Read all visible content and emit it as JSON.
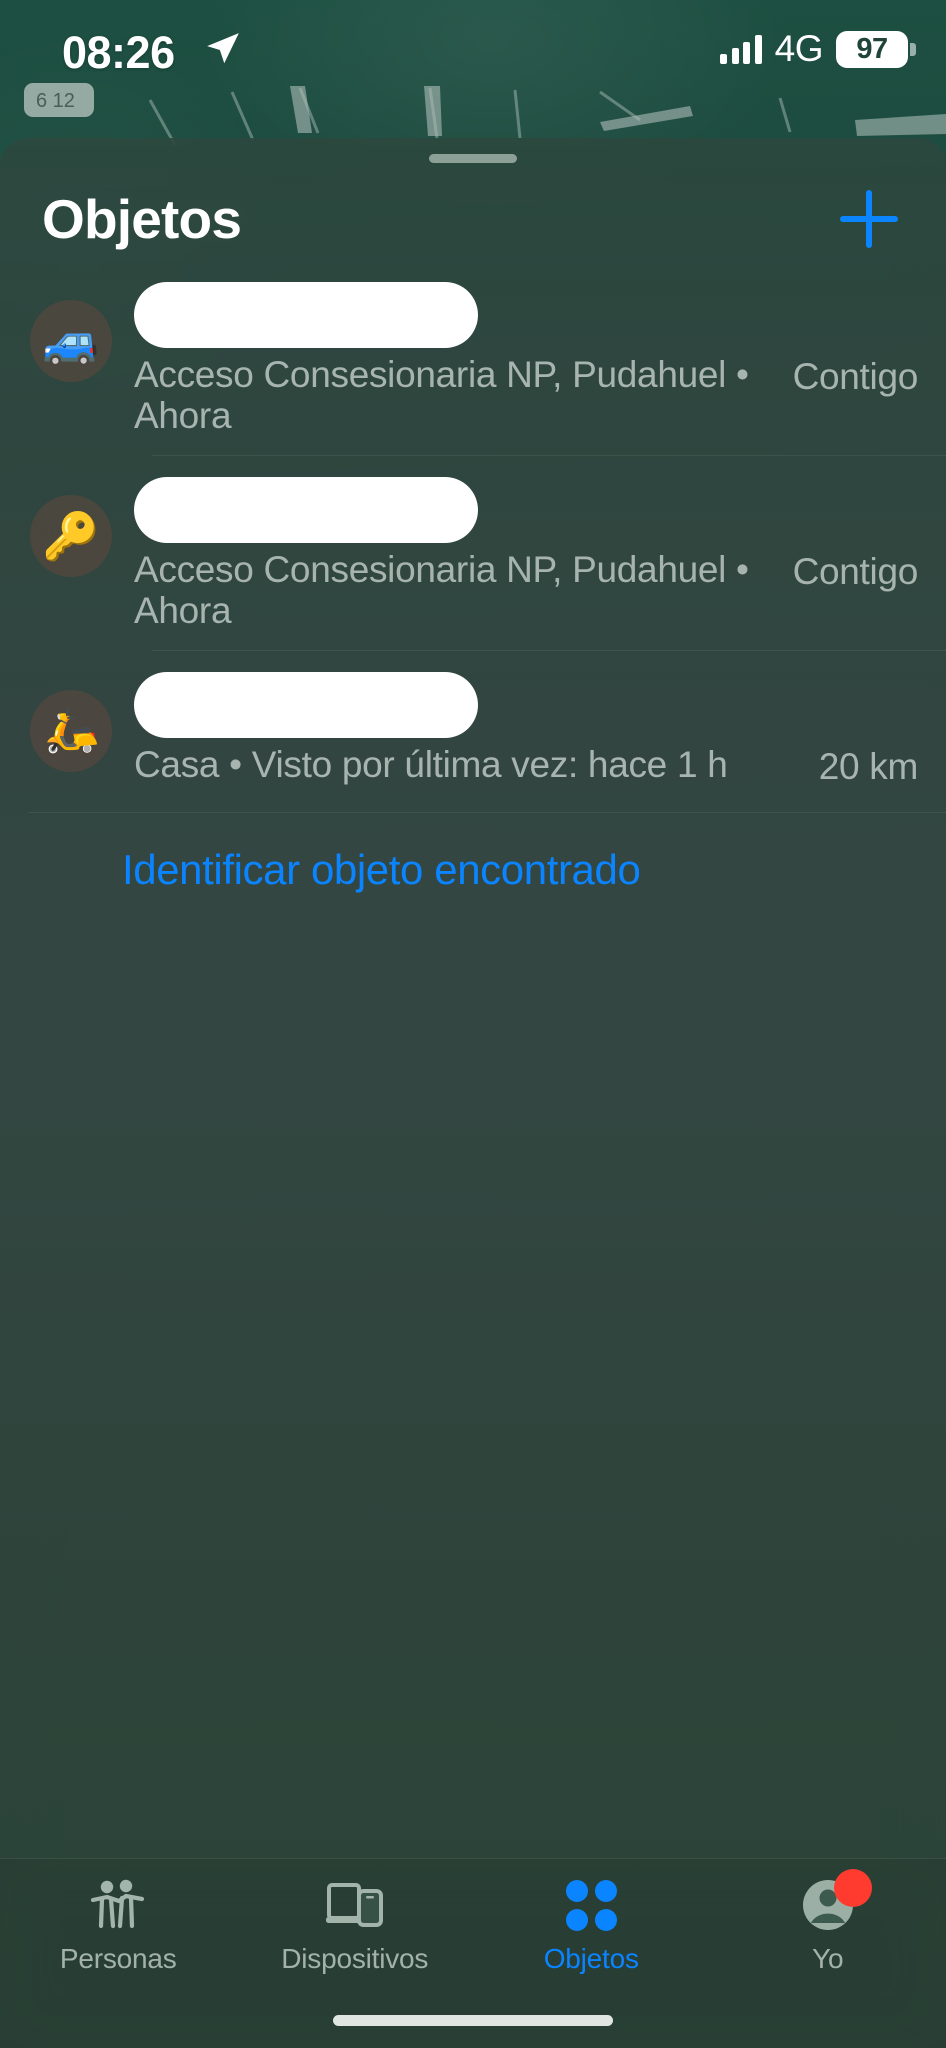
{
  "status_bar": {
    "time": "08:26",
    "location_arrow_icon": "location-arrow-icon",
    "signal_icon": "cellular-signal-icon",
    "network": "4G",
    "battery_percent": "97"
  },
  "map": {
    "background_color": "#23463b",
    "description": "dark-green-map-background"
  },
  "sheet": {
    "grabber": "sheet-grabber-handle",
    "title": "Objetos",
    "add_button_icon": "plus-icon"
  },
  "items": [
    {
      "icon": "🚙",
      "icon_name": "car-emoji-icon",
      "name_redacted": true,
      "subtitle": "Acceso Consesionaria NP, Pudahuel • Ahora",
      "meta": "Contigo"
    },
    {
      "icon": "🔑",
      "icon_name": "key-emoji-icon",
      "name_redacted": true,
      "subtitle": "Acceso Consesionaria NP, Pudahuel • Ahora",
      "meta": "Contigo"
    },
    {
      "icon": "🛵",
      "icon_name": "motor-scooter-emoji-icon",
      "name_redacted": true,
      "subtitle": "Casa • Visto por última vez: hace 1 h",
      "meta": "20 km"
    }
  ],
  "found_item_link": {
    "label": "Identificar objeto encontrado"
  },
  "tab_bar": {
    "tabs": [
      {
        "label": "Personas",
        "icon": "people-icon",
        "active": false
      },
      {
        "label": "Dispositivos",
        "icon": "devices-icon",
        "active": false
      },
      {
        "label": "Objetos",
        "icon": "items-dots-icon",
        "active": true
      },
      {
        "label": "Yo",
        "icon": "person-avatar-icon",
        "active": false,
        "badge": true
      }
    ]
  },
  "colors": {
    "accent_blue": "#0a84ff",
    "badge_red": "#ff3b30",
    "sheet_tint": "#344a42",
    "map_green": "#23463b"
  }
}
